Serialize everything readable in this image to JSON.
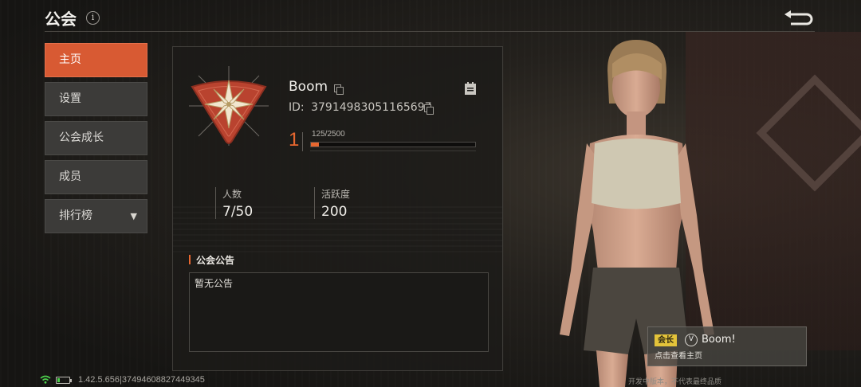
{
  "header": {
    "title": "公会",
    "info_icon": "info-icon",
    "back_icon": "return-arrow-icon"
  },
  "sidebar": {
    "items": [
      {
        "label": "主页",
        "active": true
      },
      {
        "label": "设置",
        "active": false
      },
      {
        "label": "公会成长",
        "active": false
      },
      {
        "label": "成员",
        "active": false
      },
      {
        "label": "排行榜",
        "active": false,
        "dropdown": true
      }
    ]
  },
  "guild": {
    "name": "Boom",
    "id_label": "ID:",
    "id_value": "37914983051165697",
    "level": "1",
    "xp_text": "125/2500",
    "xp_fraction": 0.05,
    "stats": [
      {
        "label": "人数",
        "value": "7/50"
      },
      {
        "label": "活跃度",
        "value": "200"
      }
    ],
    "announcement_title": "公会公告",
    "announcement_text": "暂无公告"
  },
  "leader": {
    "badge": "会长",
    "name": "Boom!",
    "hint": "点击查看主页"
  },
  "footer": {
    "version": "1.42.5.656|37494608827449345",
    "disclaimer": "开发中版本，不代表最终品质"
  },
  "colors": {
    "accent": "#d85a33",
    "level_orange": "#e8672f",
    "badge_yellow": "#e3c33a",
    "wifi_green": "#4ccf4c"
  }
}
